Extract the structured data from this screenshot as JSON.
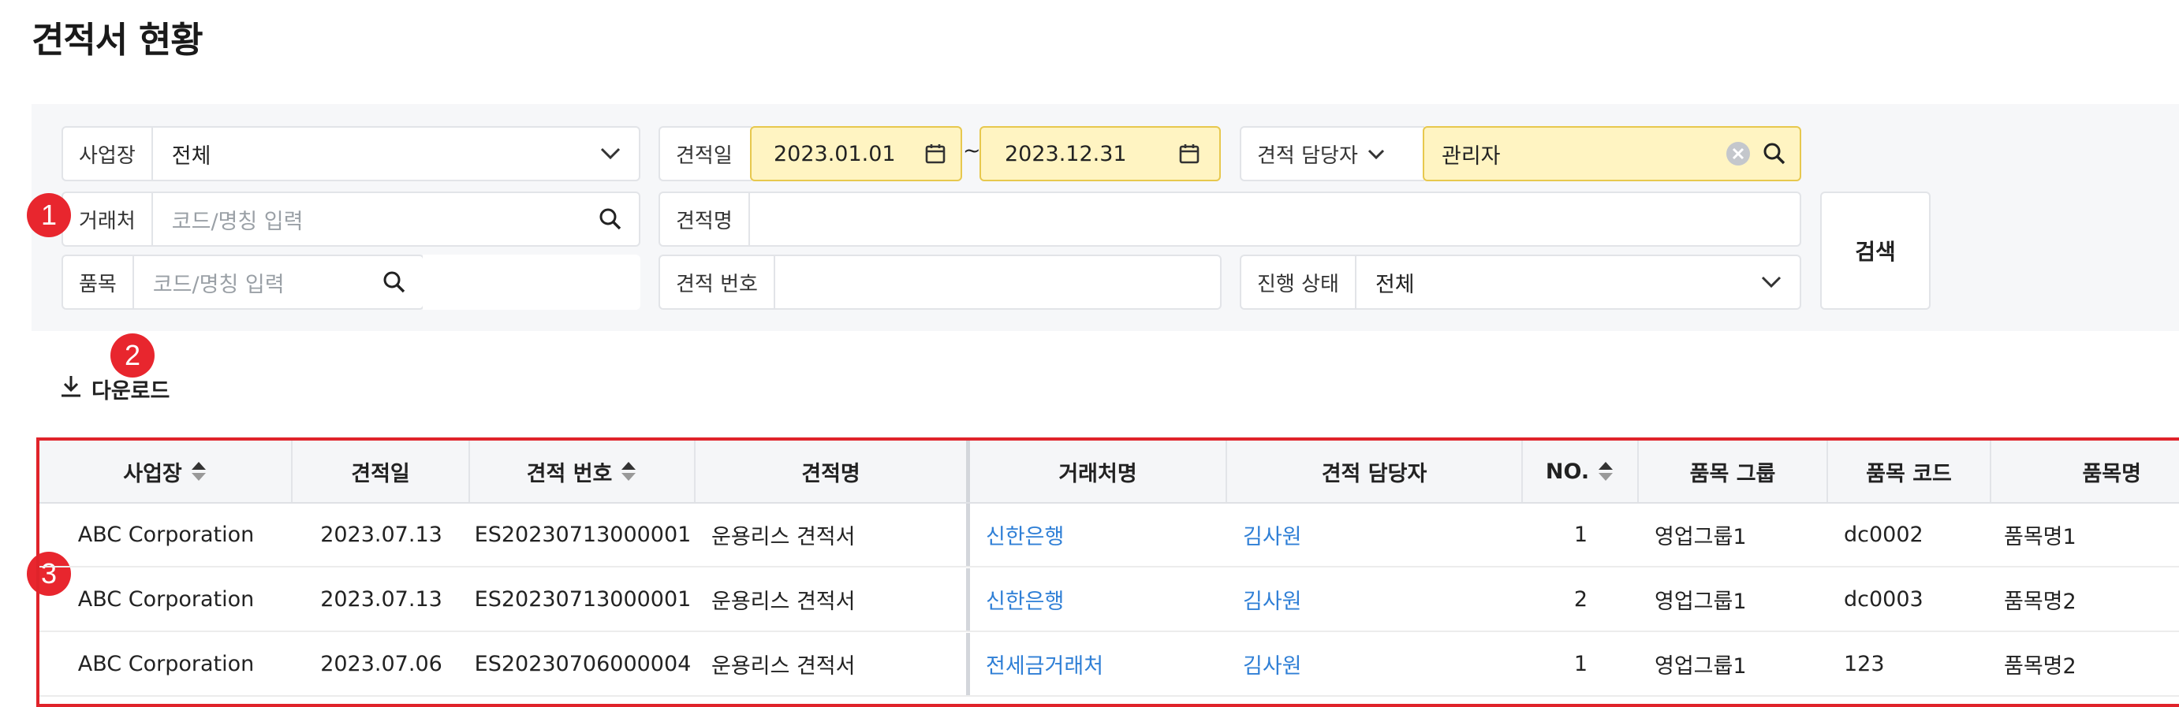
{
  "page_title": "견적서 현황",
  "filters": {
    "workplace": {
      "label": "사업장",
      "value": "전체"
    },
    "estimate_date": {
      "label": "견적일",
      "from": "2023.01.01",
      "separator": "~",
      "to": "2023.12.31"
    },
    "manager": {
      "label": "견적 담당자",
      "value": "관리자"
    },
    "client": {
      "label": "거래처",
      "placeholder": "코드/명칭 입력"
    },
    "estimate_name": {
      "label": "견적명",
      "value": ""
    },
    "item": {
      "label": "품목",
      "placeholder": "코드/명칭 입력"
    },
    "estimate_number": {
      "label": "견적 번호",
      "value": ""
    },
    "status": {
      "label": "진행 상태",
      "value": "전체"
    },
    "search_label": "검색"
  },
  "badges": [
    "1",
    "2",
    "3"
  ],
  "download_label": "다운로드",
  "table": {
    "columns": [
      "사업장",
      "견적일",
      "견적 번호",
      "견적명",
      "거래처명",
      "견적 담당자",
      "NO.",
      "품목 그룹",
      "품목 코드",
      "품목명"
    ],
    "rows": [
      [
        "ABC Corporation",
        "2023.07.13",
        "ES20230713000001",
        "운용리스 견적서",
        "신한은행",
        "김사원",
        "1",
        "영업그룹1",
        "dc0002",
        "품목명1"
      ],
      [
        "ABC Corporation",
        "2023.07.13",
        "ES20230713000001",
        "운용리스 견적서",
        "신한은행",
        "김사원",
        "2",
        "영업그룹1",
        "dc0003",
        "품목명2"
      ],
      [
        "ABC Corporation",
        "2023.07.06",
        "ES20230706000004",
        "운용리스 견적서",
        "전세금거래처",
        "김사원",
        "1",
        "영업그룹1",
        "123",
        "품목명2"
      ]
    ]
  },
  "colors": {
    "highlight": "#fff4c2",
    "accent_red": "#e8262e",
    "link": "#2f7fd6"
  }
}
